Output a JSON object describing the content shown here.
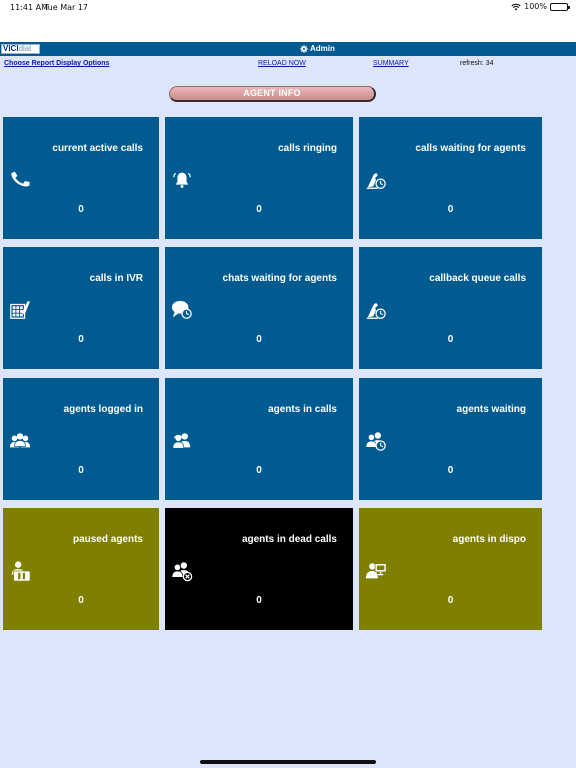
{
  "statusbar": {
    "time": "11:41 AM",
    "date": "Tue Mar 17",
    "battery": "100%"
  },
  "header": {
    "logo": {
      "part1": "VICI",
      "part2": "dial"
    },
    "user": "Admin"
  },
  "options": {
    "choose": "Choose Report Display Options",
    "reload": "RELOAD NOW",
    "summary": "SUMMARY",
    "refresh": "refresh: 34"
  },
  "section_title": "AGENT INFO",
  "colors": {
    "blue": "#015b91",
    "olive": "#7f7f00",
    "black": "#000000",
    "page": "#dde5fb"
  },
  "tiles": [
    {
      "label": "current active calls",
      "value": "0",
      "icon": "phone-icon"
    },
    {
      "label": "calls ringing",
      "value": "0",
      "icon": "bell-icon"
    },
    {
      "label": "calls waiting for agents",
      "value": "0",
      "icon": "phone-clock-icon"
    },
    {
      "label": "calls in IVR",
      "value": "0",
      "icon": "keypad-phone-icon"
    },
    {
      "label": "chats waiting for agents",
      "value": "0",
      "icon": "chat-clock-icon"
    },
    {
      "label": "callback queue calls",
      "value": "0",
      "icon": "phone-clock-icon"
    },
    {
      "label": "agents logged in",
      "value": "0",
      "icon": "agents-group-icon"
    },
    {
      "label": "agents in calls",
      "value": "0",
      "icon": "agent-headset-icon"
    },
    {
      "label": "agents waiting",
      "value": "0",
      "icon": "agent-clock-icon"
    },
    {
      "label": "paused agents",
      "value": "0",
      "icon": "agent-pause-icon"
    },
    {
      "label": "agents in dead calls",
      "value": "0",
      "icon": "agent-dead-icon"
    },
    {
      "label": "agents in dispo",
      "value": "0",
      "icon": "agent-screen-icon"
    }
  ]
}
